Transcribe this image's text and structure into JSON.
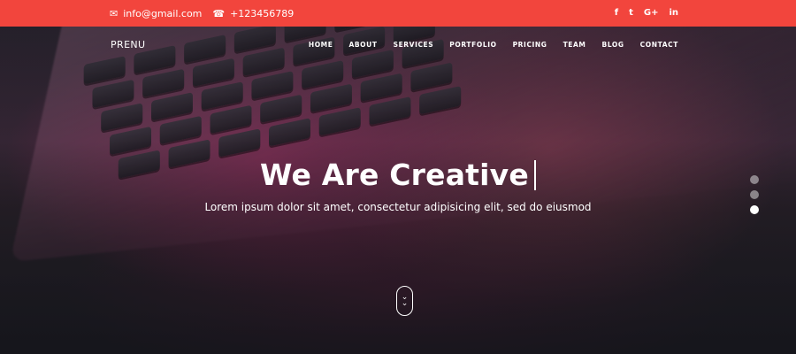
{
  "topbar": {
    "email": "info@gmail.com",
    "phone": "+123456789",
    "email_icon": "envelope-icon",
    "phone_icon": "phone-icon",
    "social": [
      {
        "name": "facebook-icon",
        "glyph": "f"
      },
      {
        "name": "twitter-icon",
        "glyph": "t"
      },
      {
        "name": "google-plus-icon",
        "glyph": "G+"
      },
      {
        "name": "linkedin-icon",
        "glyph": "in"
      }
    ],
    "color": "#f2453d"
  },
  "nav": {
    "brand": "PRENU",
    "items": [
      "HOME",
      "ABOUT",
      "SERVICES",
      "PORTFOLIO",
      "PRICING",
      "TEAM",
      "BLOG",
      "CONTACT"
    ]
  },
  "hero": {
    "headline": "We Are Creative",
    "subtitle": "Lorem ipsum dolor sit amet, consectetur adipisicing elit, sed do eiusmod",
    "slides": 3,
    "active_slide": 3,
    "scroll_icon": "double-chevron-down-icon"
  }
}
